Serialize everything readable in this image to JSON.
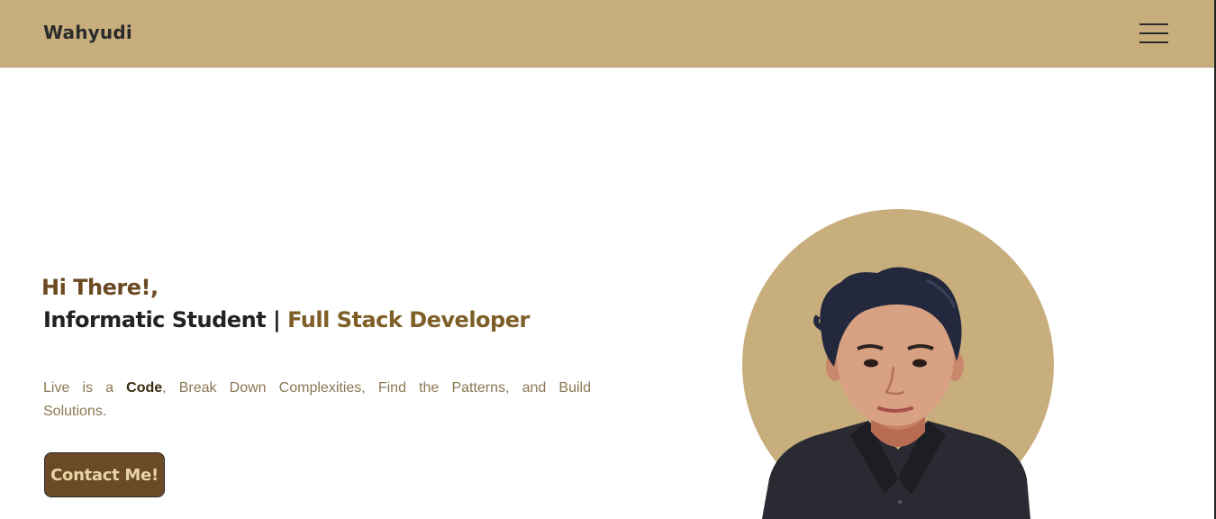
{
  "navbar": {
    "brand": "Wahyudi",
    "menu_icon": "hamburger-menu-icon",
    "background": "#c8ae7d"
  },
  "hero": {
    "greeting": "Hi There!,",
    "role_prefix": "Informatic Student",
    "role_separator": " | ",
    "role_highlight": "Full Stack Developer",
    "tagline_before": "Live is a ",
    "tagline_bold": "Code",
    "tagline_after": ", Break Down Complexities, Find the Patterns, and Build Solutions.",
    "cta_label": "Contact Me!",
    "portrait_icon": "profile-photo"
  },
  "colors": {
    "accent_brown": "#6b4a27",
    "highlight": "#7e5f27",
    "circle": "#c8ae7d",
    "shirt": "#2a2a33"
  }
}
